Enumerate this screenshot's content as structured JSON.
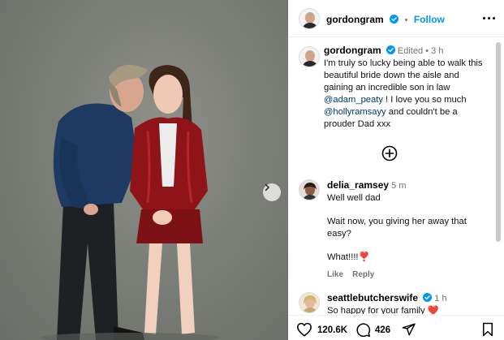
{
  "header": {
    "username": "gordongram",
    "follow_label": "Follow"
  },
  "caption": {
    "username": "gordongram",
    "edited": "Edited",
    "separator": "•",
    "time": "3 h",
    "text_1": "I'm truly so lucky being able to walk this beautiful bride down the aisle and gaining an incredible son in law",
    "mention_1": "@adam_peaty",
    "text_2": " ! I love you so much ",
    "mention_2": "@hollyramsayy",
    "text_3": " and couldn't be a prouder Dad xxx"
  },
  "comments": [
    {
      "username": "delia_ramsey",
      "time": "5 m",
      "lines": [
        "Well well dad",
        "Wait now, you giving her away that easy?",
        "What!!!!❣️"
      ],
      "like_label": "Like",
      "reply_label": "Reply"
    },
    {
      "username": "seattlebutcherswife",
      "time": "1 h",
      "text": "So happy for your family ❤️"
    }
  ],
  "footer": {
    "likes": "120.6K",
    "comments": "426"
  },
  "icons": {
    "verified": "verified-badge-icon",
    "more": "more-options-icon",
    "add_comment": "add-circle-icon",
    "carousel_next": "chevron-right-icon",
    "like": "heart-icon",
    "comment": "comment-bubble-icon",
    "share": "send-icon",
    "save": "bookmark-icon"
  },
  "colors": {
    "link": "#0095f6",
    "mention": "#00376b",
    "verified": "#0095f6",
    "meta": "#737373"
  }
}
